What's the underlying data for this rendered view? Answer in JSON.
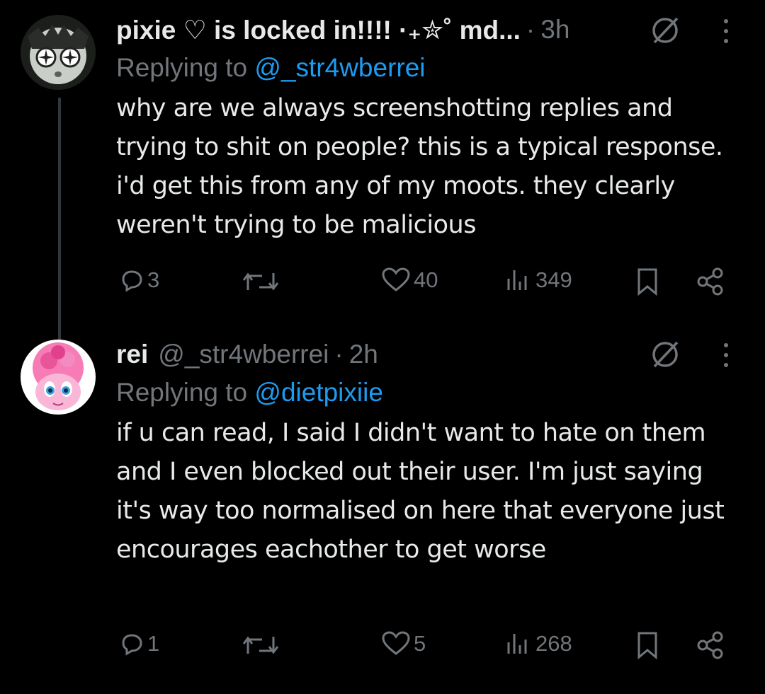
{
  "tweets": [
    {
      "display_name": "pixie ♡ is locked in!!!! ·₊✮˚ md...",
      "handle": "",
      "time": "3h",
      "replying_label": "Replying to",
      "replying_to": "@_str4wberrei",
      "text": "why are we always screenshotting replies and trying to shit on people? this is a typical response. i'd get this from any of my moots. they clearly weren't trying to be malicious",
      "replies": "3",
      "retweets": "",
      "likes": "40",
      "views": "349"
    },
    {
      "display_name": "rei",
      "handle": "@_str4wberrei",
      "time": "2h",
      "replying_label": "Replying to",
      "replying_to": "@dietpixiie",
      "text": "if u can read, I said I didn't want to hate on them and I even blocked out their user. I'm just saying it's way too normalised on here that everyone just encourages eachother to get worse",
      "replies": "1",
      "retweets": "",
      "likes": "5",
      "views": "268"
    }
  ],
  "colors": {
    "background": "#000000",
    "text": "#e7e9ea",
    "muted": "#71767b",
    "link": "#1d9bf0"
  },
  "icons": [
    "grok-icon",
    "more-icon",
    "reply-icon",
    "retweet-icon",
    "like-icon",
    "views-icon",
    "bookmark-icon",
    "share-icon"
  ]
}
